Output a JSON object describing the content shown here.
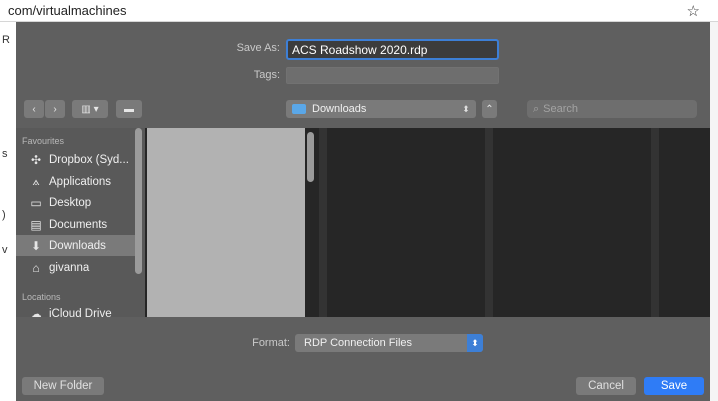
{
  "browser": {
    "url": "com/virtualmachines",
    "star_icon": "star-icon",
    "bg_fragments": [
      "R",
      "s",
      ")",
      "v"
    ]
  },
  "dialog": {
    "save_as_label": "Save As:",
    "save_as_value": "ACS Roadshow 2020.rdp",
    "tags_label": "Tags:",
    "tags_value": "",
    "toolbar": {
      "back_icon": "chevron-left-icon",
      "forward_icon": "chevron-right-icon",
      "view_icon": "column-view-icon",
      "group_icon": "folder-group-icon",
      "location": "Downloads",
      "collapse_icon": "chevron-up-icon",
      "search_placeholder": "Search"
    },
    "sidebar": {
      "favourites_header": "Favourites",
      "items": [
        {
          "label": "Dropbox (Syd...",
          "icon": "dropbox-icon",
          "selected": false
        },
        {
          "label": "Applications",
          "icon": "applications-icon",
          "selected": false
        },
        {
          "label": "Desktop",
          "icon": "desktop-icon",
          "selected": false
        },
        {
          "label": "Documents",
          "icon": "documents-icon",
          "selected": false
        },
        {
          "label": "Downloads",
          "icon": "downloads-icon",
          "selected": true
        },
        {
          "label": "givanna",
          "icon": "home-icon",
          "selected": false
        }
      ],
      "locations_header": "Locations",
      "locations": [
        {
          "label": "iCloud Drive",
          "icon": "cloud-icon"
        }
      ]
    },
    "format_label": "Format:",
    "format_value": "RDP Connection Files",
    "buttons": {
      "new_folder": "New Folder",
      "cancel": "Cancel",
      "save": "Save"
    },
    "colors": {
      "accent": "#2f7cf6",
      "dialog_bg": "#5f5f5f",
      "sidebar_bg": "#595959",
      "column_bg": "#262626"
    }
  }
}
